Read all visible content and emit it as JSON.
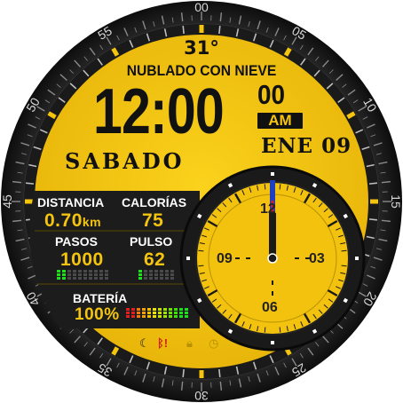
{
  "weather": {
    "temperature": "31°",
    "condition": "NUBLADO CON NIEVE"
  },
  "time": {
    "hours_minutes": "12:00",
    "seconds": "00",
    "ampm": "AM"
  },
  "date": {
    "month_day": "ENE 09",
    "weekday": "SABADO"
  },
  "metrics": {
    "distance": {
      "label": "DISTANCIA",
      "value": "0.70",
      "unit": "km"
    },
    "calories": {
      "label": "CALORÍAS",
      "value": "75"
    },
    "steps": {
      "label": "PASOS",
      "value": "1000"
    },
    "pulse": {
      "label": "PULSO",
      "value": "62"
    },
    "battery": {
      "label": "BATERÍA",
      "value": "100%",
      "level": 1.0
    }
  },
  "subdial": {
    "numerals": [
      "12",
      "03",
      "06",
      "09"
    ]
  },
  "bezel": {
    "numbers": [
      "00",
      "05",
      "10",
      "15",
      "20",
      "25",
      "30",
      "35",
      "40",
      "45",
      "50",
      "55"
    ]
  },
  "status_icons": [
    "moon-icon",
    "bluetooth-disconnected-icon",
    "lock-icon",
    "alarm-icon"
  ],
  "colors": {
    "dial_yellow": "#f5c40f",
    "bezel_dark": "#1c1c1c",
    "hand_blue": "#1f3fbf",
    "hand_red": "#d01e1e"
  }
}
